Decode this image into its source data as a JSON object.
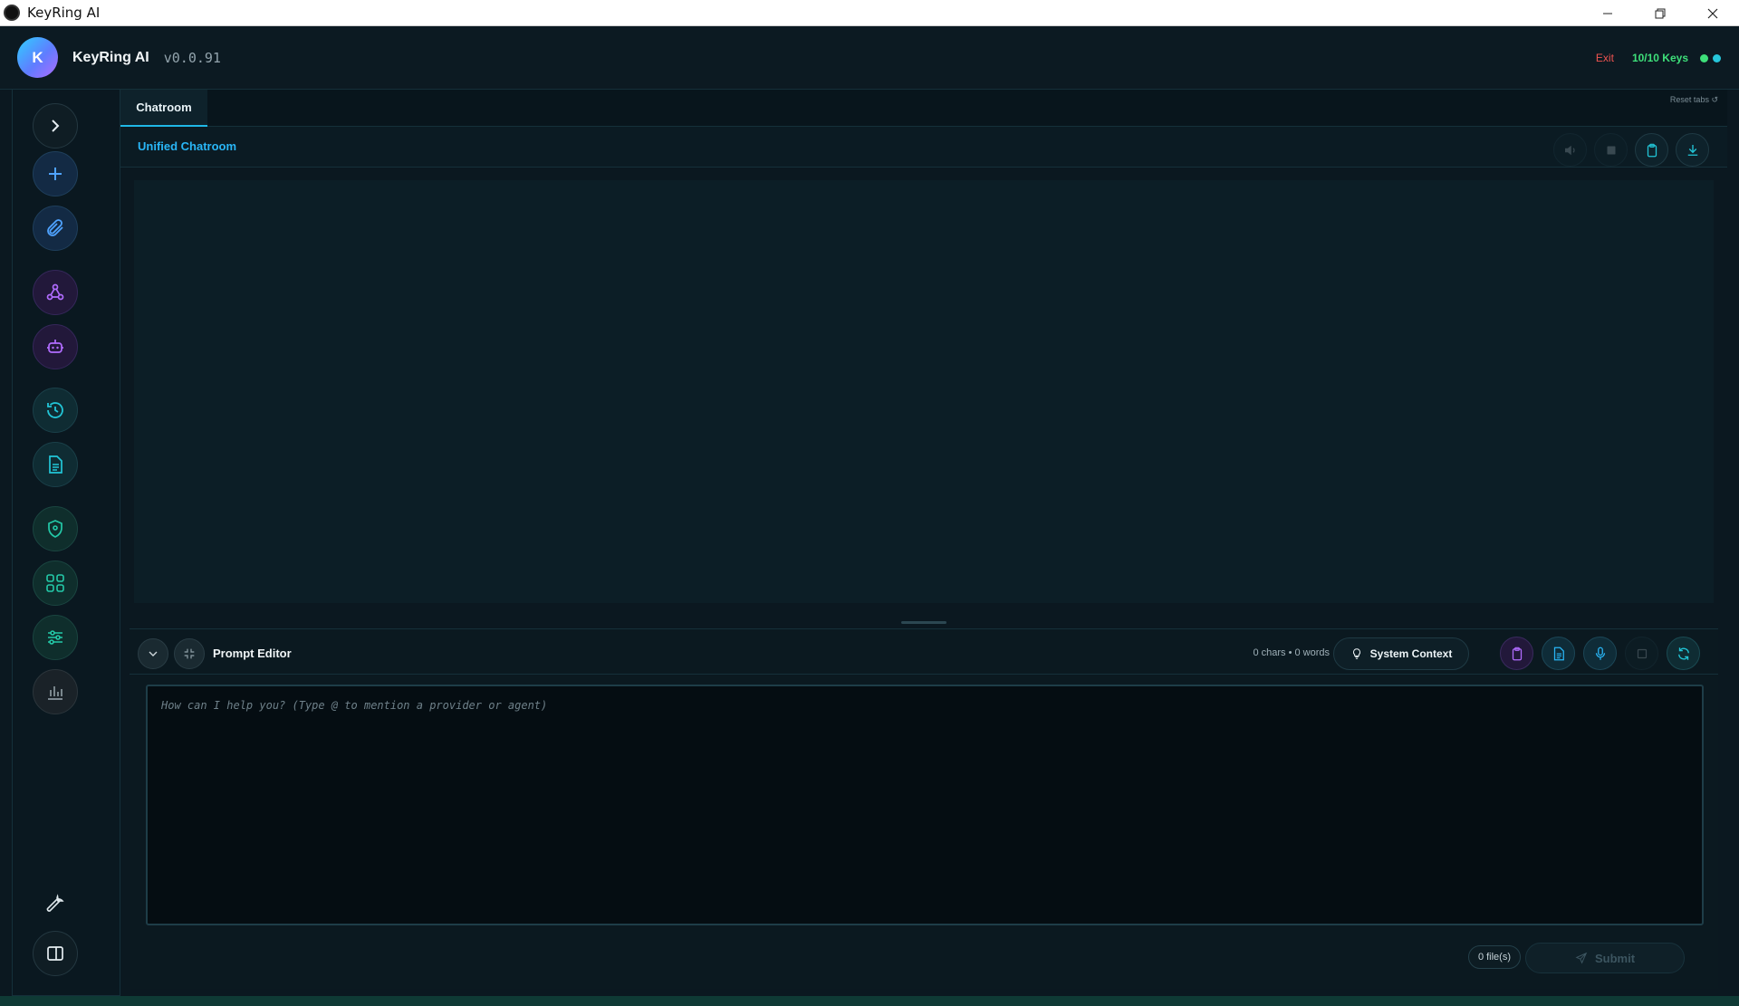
{
  "window": {
    "title": "KeyRing AI"
  },
  "header": {
    "avatar_letter": "K",
    "app_name": "KeyRing AI",
    "version": "v0.0.91",
    "exit_label": "Exit",
    "keys_status": "10/10 Keys",
    "status_colors": [
      "#3ee07a",
      "#26c6da"
    ]
  },
  "sidebar": {
    "items": [
      {
        "name": "expand",
        "icon": "chevron-right-icon"
      },
      {
        "name": "new",
        "icon": "plus-icon"
      },
      {
        "name": "attach",
        "icon": "paperclip-icon"
      },
      {
        "name": "providers",
        "icon": "network-icon"
      },
      {
        "name": "agents",
        "icon": "robot-icon"
      },
      {
        "name": "history",
        "icon": "history-icon"
      },
      {
        "name": "documents",
        "icon": "document-icon"
      },
      {
        "name": "security",
        "icon": "shield-icon"
      },
      {
        "name": "shortcuts",
        "icon": "command-icon"
      },
      {
        "name": "settings",
        "icon": "sliders-icon"
      },
      {
        "name": "stats",
        "icon": "bar-chart-icon"
      },
      {
        "name": "tools",
        "icon": "wrench-icon"
      },
      {
        "name": "toggle-panel",
        "icon": "panel-icon"
      }
    ]
  },
  "tabs": {
    "active": "Chatroom",
    "reset_label": "Reset tabs ↺"
  },
  "chat": {
    "title": "Unified Chatroom"
  },
  "editor": {
    "title": "Prompt Editor",
    "count": "0 chars • 0 words",
    "system_context_label": "System Context",
    "placeholder": "How can I help you? (Type @ to mention a provider or agent)",
    "files": "0 file(s)",
    "submit_label": "Submit"
  }
}
